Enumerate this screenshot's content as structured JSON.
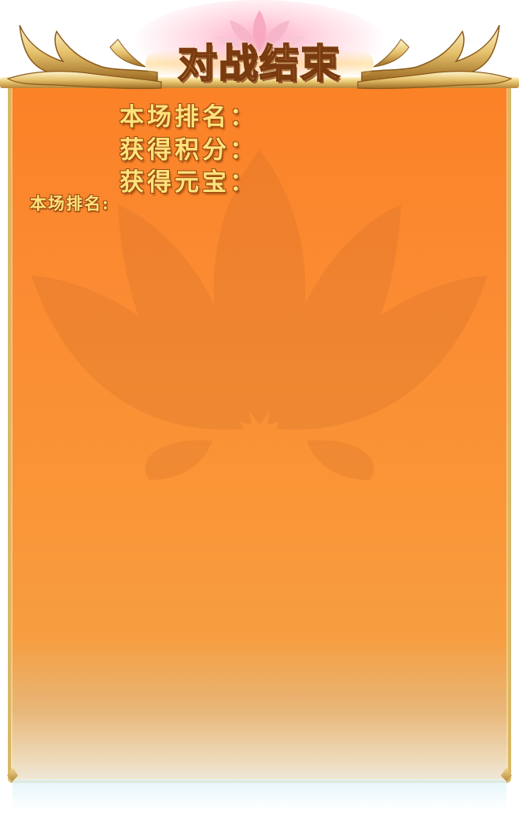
{
  "header": {
    "title": "对战结束"
  },
  "stats": {
    "rank_label": "本场排名：",
    "rank_value": "",
    "points_label": "获得积分：",
    "points_value": "",
    "ingots_label": "获得元宝："
  },
  "list": {
    "rank_label_small": "本场排名:"
  },
  "colors": {
    "panel_top": "#fb8126",
    "panel_bottom": "#efe7d8",
    "frame_gold": "#d8b766",
    "text_gold": "#ffe27a",
    "title_outline": "#7a3a10"
  },
  "icons": {
    "ornament": "gold-wing-ornament-icon",
    "watermark": "lotus-icon"
  }
}
